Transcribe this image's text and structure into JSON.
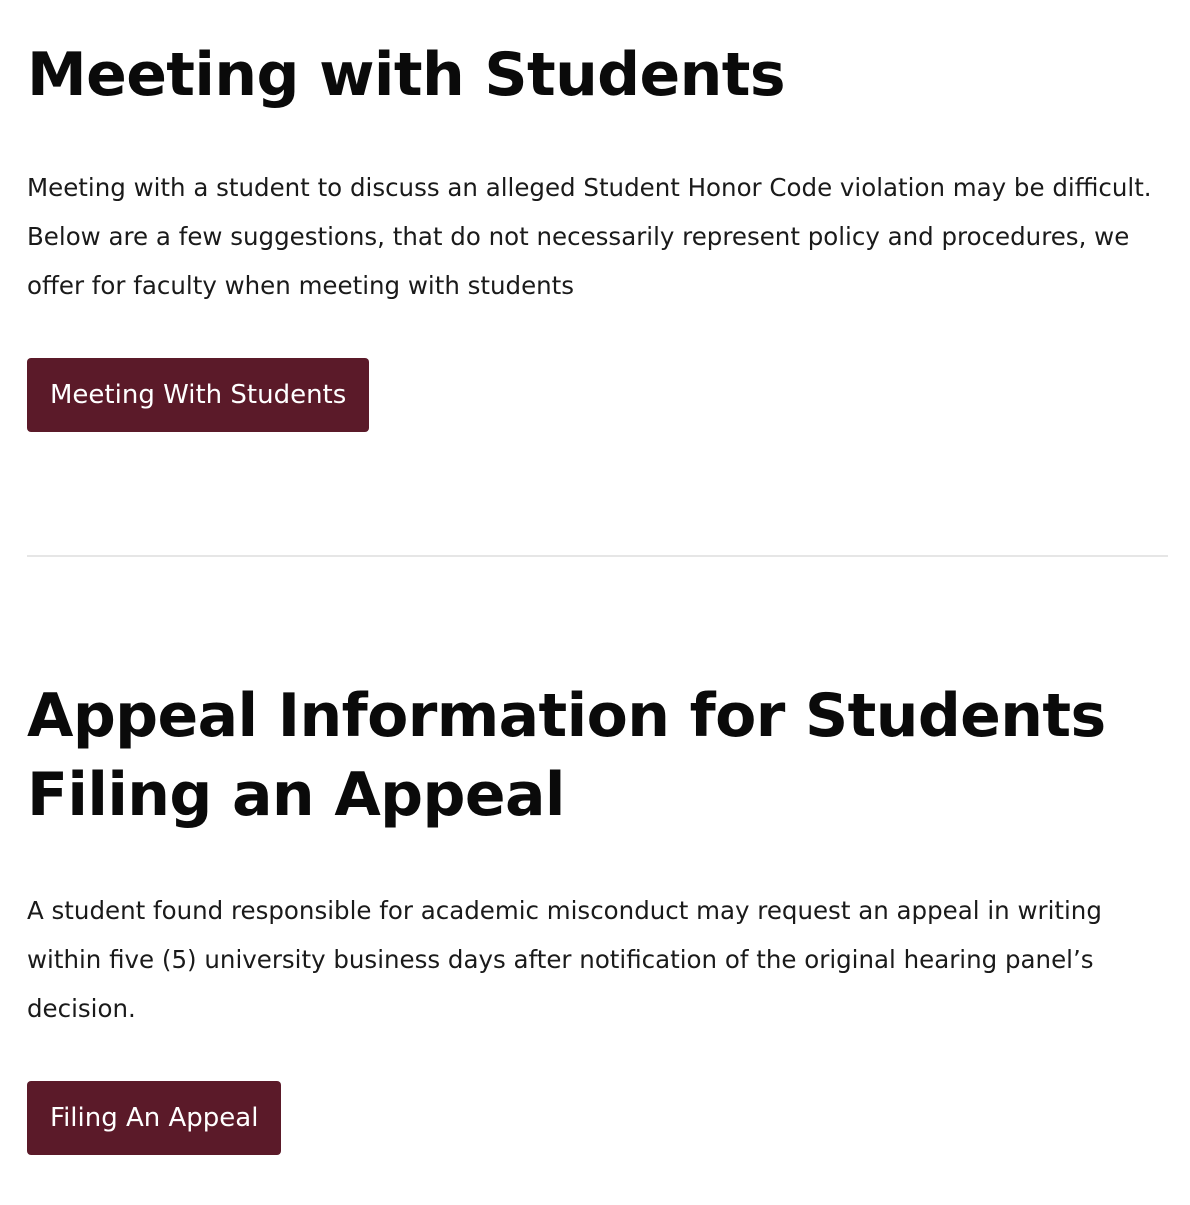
{
  "section_meeting": {
    "title": "Meeting with Students",
    "body": "Meeting with a student to discuss an alleged Student Honor Code violation may be difficult. Below are a few suggestions, that do not necessarily represent policy and procedures, we offer for faculty when meeting with students",
    "button_label": "Meeting With Students"
  },
  "section_appeal": {
    "title": "Appeal Information for Students Filing an Appeal",
    "body": "A student found responsible for academic misconduct may request an appeal in writing within five (5) university business days after notification of the original hearing panel’s decision.",
    "button_label": "Filing An Appeal"
  },
  "colors": {
    "button_background": "#5b1a29",
    "button_text": "#ffffff",
    "divider": "#e6e6e6",
    "text": "#111111"
  }
}
